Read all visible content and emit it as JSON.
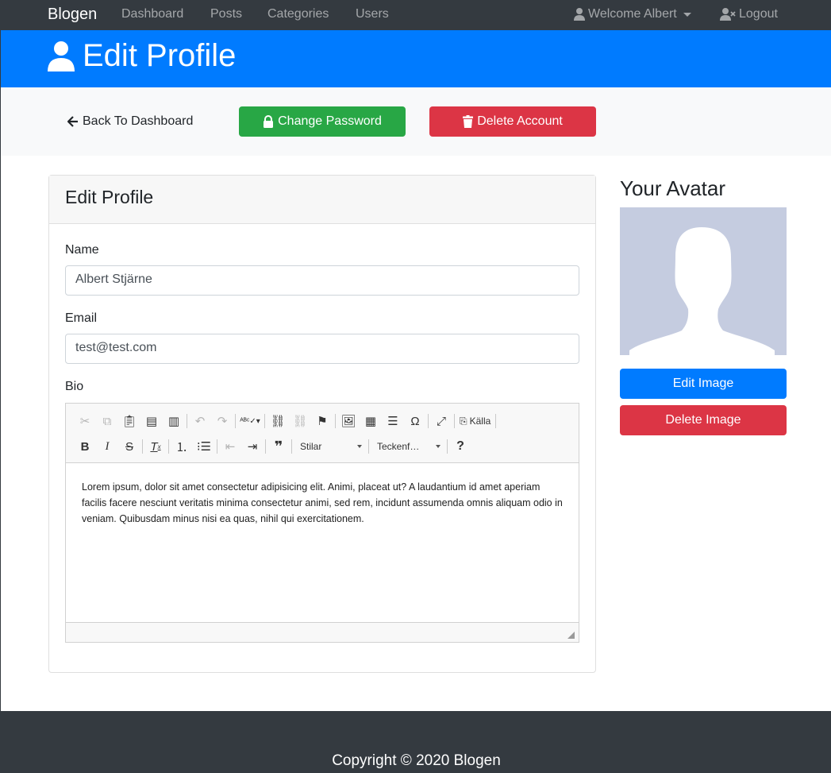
{
  "nav": {
    "brand": "Blogen",
    "links": [
      "Dashboard",
      "Posts",
      "Categories",
      "Users"
    ],
    "user_menu": "Welcome Albert",
    "logout": "Logout"
  },
  "header": {
    "title": "Edit Profile"
  },
  "actions": {
    "back": "Back To Dashboard",
    "change_password": "Change Password",
    "delete_account": "Delete Account"
  },
  "form": {
    "card_title": "Edit Profile",
    "name_label": "Name",
    "name_value": "Albert Stjärne",
    "email_label": "Email",
    "email_value": "test@test.com",
    "bio_label": "Bio",
    "editor": {
      "source_label": "Källa",
      "styles_combo": "Stilar",
      "font_combo": "Teckenf…",
      "help_label": "?",
      "content": "Lorem ipsum, dolor sit amet consectetur adipisicing elit. Animi, placeat ut? A laudantium id amet aperiam facilis facere nesciunt veritatis minima consectetur animi, sed rem, incidunt assumenda omnis aliquam odio in veniam. Quibusdam minus nisi ea quas, nihil qui exercitationem."
    }
  },
  "avatar": {
    "title": "Your Avatar",
    "edit_label": "Edit Image",
    "delete_label": "Delete Image"
  },
  "footer": {
    "copyright": "Copyright © 2020 Blogen"
  },
  "colors": {
    "navbar": "#343a40",
    "primary": "#007bff",
    "success": "#28a745",
    "danger": "#dc3545",
    "avatar_bg": "#c5cce0"
  }
}
